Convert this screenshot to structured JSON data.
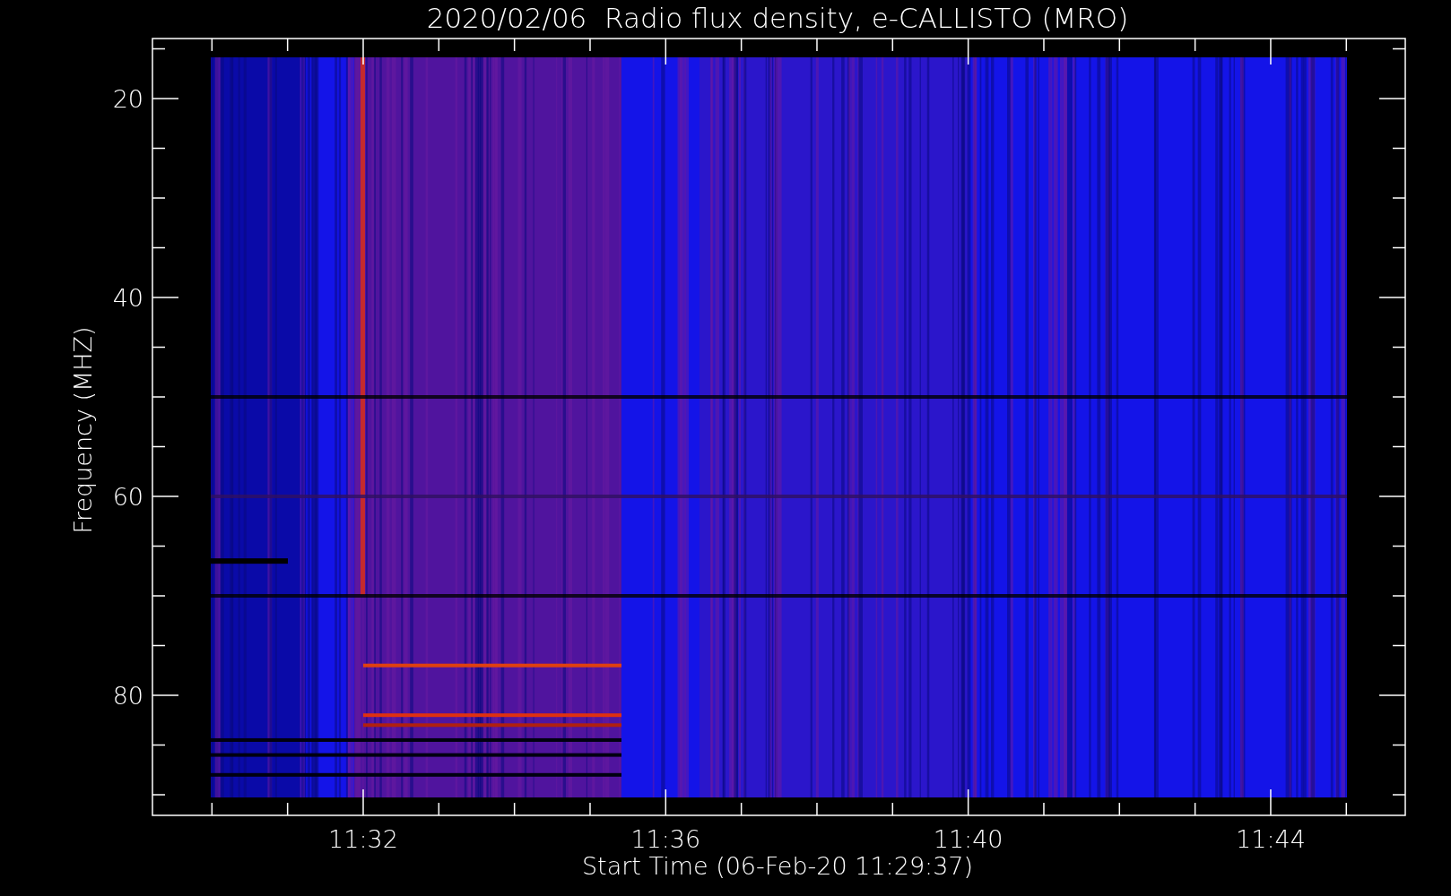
{
  "title": "2020/02/06  Radio flux density, e-CALLISTO (MRO)",
  "y_axis": {
    "label": "Frequency (MHZ)",
    "ticks": [
      "20",
      "40",
      "60",
      "80"
    ]
  },
  "x_axis": {
    "label": "Start Time (06-Feb-20 11:29:37)",
    "ticks": [
      "11:32",
      "11:36",
      "11:40",
      "11:44"
    ]
  }
}
